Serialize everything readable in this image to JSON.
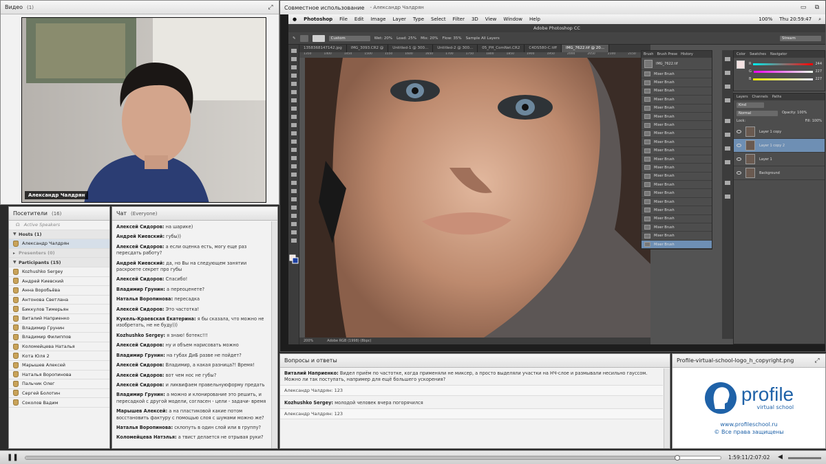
{
  "video": {
    "title": "Видео",
    "count": "(1)",
    "camera_name": "Александр Чалдрян"
  },
  "attendees": {
    "title": "Посетители",
    "count": "(16)",
    "active_speakers": "Active Speakers",
    "hosts_label": "Hosts (1)",
    "host": "Александр Чалдрян",
    "presenters_label": "Presenters (0)",
    "participants_label": "Participants (15)",
    "participants": [
      "Kozhushko Sergey",
      "Андрей Киевский",
      "Анна Воробьёва",
      "Антонова Светлана",
      "Биккулов Тимерьян",
      "Виталий Наприенко",
      "Владимир Грунин",
      "Владимир Филиппов",
      "Коломейцева Наталья",
      "Кота Юля 2",
      "Марышев Алексей",
      "Наталья Воропинова",
      "Пальчик Олег",
      "Сергей Болотин",
      "Соколов Вадим"
    ]
  },
  "chat": {
    "title": "Чат",
    "scope": "(Everyone)",
    "messages": [
      {
        "author": "Алексей Сидоров:",
        "text": " на шарике)"
      },
      {
        "author": "Андрей Киевский:",
        "text": " губы))"
      },
      {
        "author": "Алексей Сидоров:",
        "text": " а если оценка есть, могу еще раз пересдать работу?"
      },
      {
        "author": "Андрей Киевский:",
        "text": " да, но Вы на следующем занятии раскроете секрет про губы"
      },
      {
        "author": "Алексей Сидоров:",
        "text": " Спасибо!"
      },
      {
        "author": "Владимир Грунин:",
        "text": " а переоценете?"
      },
      {
        "author": "Наталья Воропинова:",
        "text": " пересадка"
      },
      {
        "author": "Алексей Сидоров:",
        "text": " Это частотка!"
      },
      {
        "author": "Кукель-Краевская Екатерина:",
        "text": " я бы сказала, что можно не изобретать, не не буду)))"
      },
      {
        "author": "Kozhushko Sergey:",
        "text": " я знаю! ботекс!!!"
      },
      {
        "author": "Алексей Сидоров:",
        "text": " ну и объем нарисовать можно"
      },
      {
        "author": "Владимир Грунин:",
        "text": " на губах ДиБ разве не пойдет?"
      },
      {
        "author": "Алексей Сидоров:",
        "text": " Владимир, а какая разница?! Время!"
      },
      {
        "author": "Алексей Сидоров:",
        "text": " вот чем нос не губы?"
      },
      {
        "author": "Алексей Сидоров:",
        "text": " и ликвифаем  правельнуюформу предать"
      },
      {
        "author": "Владимир Грунин:",
        "text": " а можно и клонирование это решить, и пересадкой с другой модели, согласен - цели - задачи- время"
      },
      {
        "author": "Марышев Алексей:",
        "text": " а на пластиковой какие потом восстановить фактуру с помощью слоя с шумами можно же?"
      },
      {
        "author": "Наталья Воропинова:",
        "text": " склопуть в один слой или в группу?"
      },
      {
        "author": "Коломейцева Натэлья:",
        "text": " а твист делается не отрывая руки?"
      }
    ]
  },
  "share": {
    "title": "Совместное использование",
    "presenter": "- Александр Чалдрян",
    "menubar": {
      "app": "Photoshop",
      "items": [
        "File",
        "Edit",
        "Image",
        "Layer",
        "Type",
        "Select",
        "Filter",
        "3D",
        "View",
        "Window",
        "Help"
      ],
      "battery": "100%",
      "clock": "Thu 20:59:47"
    },
    "window_title": "Adobe Photoshop CC",
    "options": {
      "preset": "Custom",
      "wet": "Wet: 20%",
      "load": "Load: 25%",
      "mix": "Mix: 20%",
      "flow": "Flow: 35%",
      "sample": "Sample All Layers",
      "workspace": "Stream"
    },
    "doc_tabs": [
      "1358368147142.jpg",
      "IMG_3093.CR2 @",
      "Untitled-1 @ 300...",
      "Untitled-2 @ 300...",
      "05_PH_ComNet.CR2",
      "C4DS580-C.tiff",
      "IMG_7622.tif @ 20..."
    ],
    "ruler": [
      "1350",
      "1400",
      "1450",
      "1500",
      "1550",
      "1600",
      "1650",
      "1700",
      "1750",
      "1800",
      "1850",
      "1900",
      "1950",
      "2000",
      "2050",
      "2100",
      "2150",
      "2200"
    ],
    "status": {
      "zoom": "200%",
      "profile": "Adobe RGB (1998) (8bpc)"
    },
    "history": {
      "tabs": [
        "Brush",
        "Brush Prese",
        "History"
      ],
      "snapshot": "IMG_7622.tif",
      "step": "Mixer Brush",
      "steps_count": 21
    },
    "color": {
      "tabs": [
        "Color",
        "Swatches",
        "Navigator"
      ],
      "r": "244",
      "g": "227",
      "b": "227"
    },
    "layers": {
      "tabs": [
        "Layers",
        "Channels",
        "Paths"
      ],
      "kind": "Kind",
      "blend": "Normal",
      "opacity": "Opacity: 100%",
      "lock": "Lock:",
      "fill": "Fill: 100%",
      "items": [
        "Layer 1 copy",
        "Layer 1 copy 2",
        "Layer 1",
        "Background"
      ]
    }
  },
  "qa": {
    "title": "Вопросы и ответы",
    "items": [
      {
        "author": "Виталий Наприенко:",
        "text": " Видел приём по частотке, когда применяли не миксер, а просто выделяли участки на НЧ-слое и размывали несильно гауссом. Можно ли так поступать, например для ещё большего ускорения?",
        "answer": "Александр Чалдрян: 123"
      },
      {
        "author": "Kozhushko Sergey:",
        "text": " молодой человек вчера погорячился",
        "answer": "Александр Чалдрян: 123"
      }
    ]
  },
  "logo": {
    "title": "Profile-virtual-school-logo_h_copyright.png",
    "brand": "profile",
    "tagline": "virtual school",
    "url": "www.profileschool.ru",
    "copyright": "© Все права защищены"
  },
  "playback": {
    "time": "1:59:11/2:07:02",
    "progress": 0.938
  },
  "colors": {
    "brand_blue": "#1f62a8",
    "ps_selection": "#6e8fb4"
  }
}
